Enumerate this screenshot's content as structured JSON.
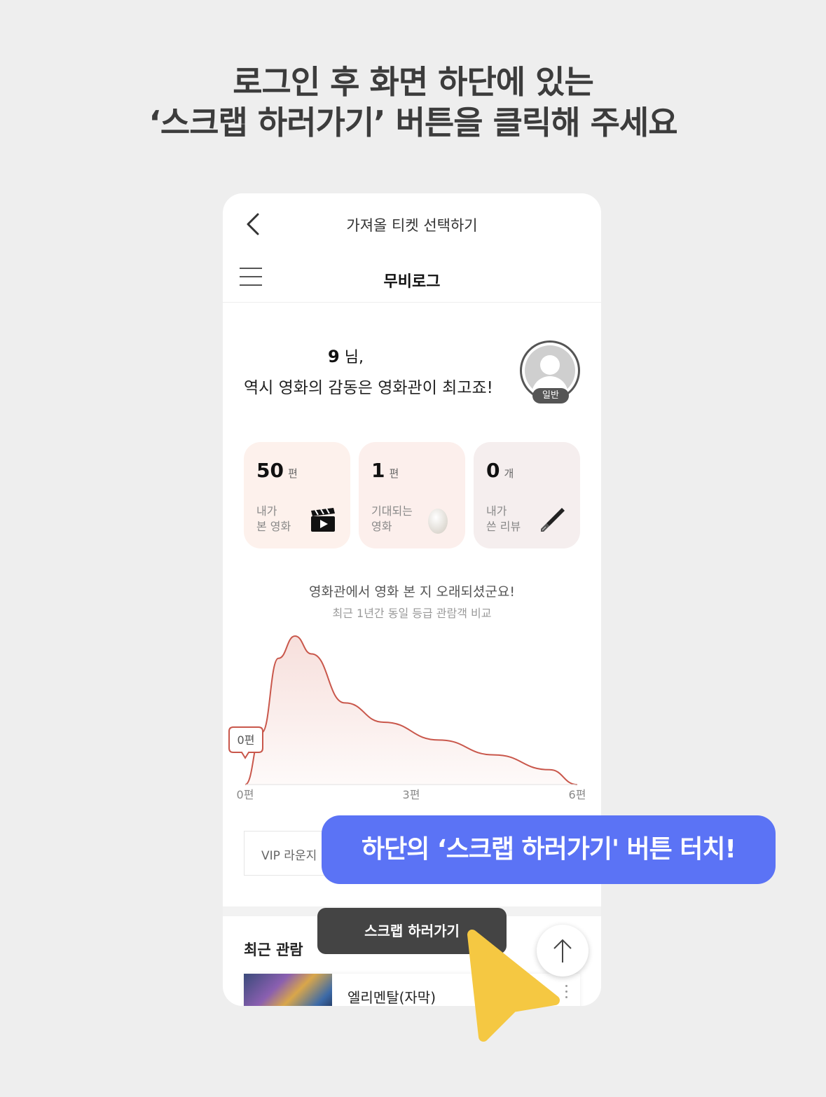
{
  "headline": {
    "line1": "로그인 후 화면 하단에 있는",
    "line2": "‘스크랩 하러가기’ 버튼을 클릭해 주세요"
  },
  "topbar": {
    "title": "가져올 티켓 선택하기"
  },
  "appbar": {
    "title": "무비로그"
  },
  "greeting": {
    "name": "9",
    "suffix": "님,",
    "message": "역시 영화의 감동은 영화관이 최고죠!",
    "grade": "일반"
  },
  "stats": [
    {
      "value": "50",
      "unit": "편",
      "label1": "내가",
      "label2": "본 영화",
      "icon": "clapperboard-icon"
    },
    {
      "value": "1",
      "unit": "편",
      "label1": "기대되는",
      "label2": "영화",
      "icon": "egg-icon"
    },
    {
      "value": "0",
      "unit": "개",
      "label1": "내가",
      "label2": "쓴 리뷰",
      "icon": "fountain-pen-icon"
    }
  ],
  "chart": {
    "title": "영화관에서 영화 본 지 오래되셨군요!",
    "subtitle": "최근 1년간 동일 등급 관람객 비교",
    "marker_label": "0편"
  },
  "chart_data": {
    "type": "area",
    "x_ticks": [
      "0편",
      "3편",
      "6편"
    ],
    "xlim": [
      0,
      6
    ],
    "marker": {
      "x": 0,
      "label": "0편"
    },
    "curve": {
      "x": [
        0,
        0.3,
        0.6,
        0.9,
        1.2,
        1.8,
        2.5,
        3.5,
        4.5,
        5.5,
        6
      ],
      "y": [
        0.0,
        0.35,
        0.85,
        1.0,
        0.88,
        0.55,
        0.42,
        0.3,
        0.2,
        0.1,
        0.0
      ]
    },
    "colors": {
      "line": "#c9574b",
      "fill": "#f6dcd8"
    }
  },
  "vip": {
    "text": "VIP 라운지"
  },
  "recent": {
    "title": "최근 관람",
    "movie_title": "엘리멘탈(자막)"
  },
  "scrap_button": {
    "label": "스크랩 하러가기"
  },
  "callout": {
    "text": "하단의 ‘스크랩 하러가기' 버튼 터치!"
  },
  "colors": {
    "accent": "#5b73f5",
    "cursor": "#f5c842",
    "button_dark": "#444444"
  }
}
